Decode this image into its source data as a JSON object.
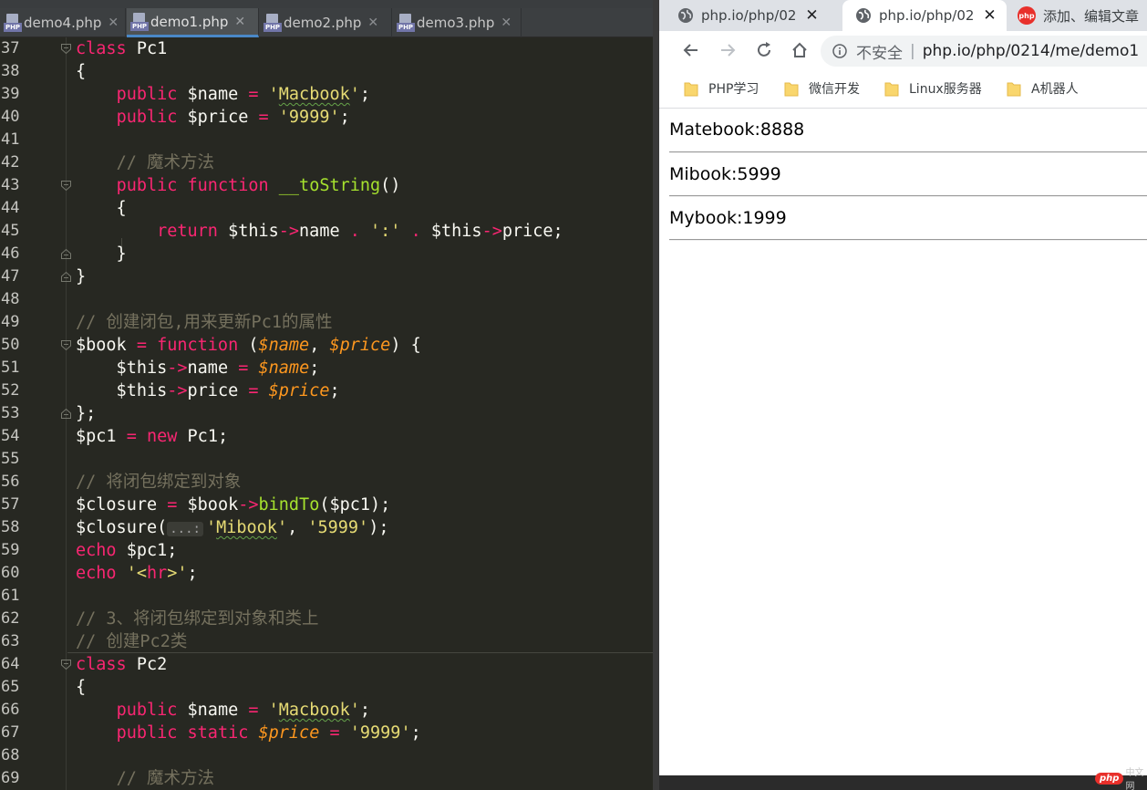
{
  "editor": {
    "menu_hint": "✎",
    "tabs": [
      {
        "label": "demo4.php",
        "active": false
      },
      {
        "label": "demo1.php",
        "active": true
      },
      {
        "label": "demo2.php",
        "active": false
      },
      {
        "label": "demo3.php",
        "active": false
      }
    ],
    "file_badge": "PHP",
    "lines": [
      {
        "n": "37",
        "html": "<span class='kw'>class</span> Pc1"
      },
      {
        "n": "38",
        "html": "{"
      },
      {
        "n": "39",
        "html": "    <span class='kw'>public</span> $name <span class='op'>=</span> <span class='str'>'<span class='squig'>Macbook</span>'</span>;"
      },
      {
        "n": "40",
        "html": "    <span class='kw'>public</span> $price <span class='op'>=</span> <span class='str'>'9999'</span>;"
      },
      {
        "n": "41",
        "html": ""
      },
      {
        "n": "42",
        "html": "    <span class='cmt'>// 魔术方法</span>"
      },
      {
        "n": "43",
        "html": "    <span class='kw'>public</span> <span class='kw'>function</span> <span class='fn'>__toString</span>()"
      },
      {
        "n": "44",
        "html": "    {"
      },
      {
        "n": "45",
        "html": "        <span class='kw'>return</span> $this<span class='op'>-&gt;</span>name <span class='op'>.</span> <span class='str'>':'</span> <span class='op'>.</span> $this<span class='op'>-&gt;</span>price;"
      },
      {
        "n": "46",
        "html": "    }"
      },
      {
        "n": "47",
        "html": "}"
      },
      {
        "n": "48",
        "html": ""
      },
      {
        "n": "49",
        "html": "<span class='cmt'>// 创建闭包,用来更新Pc1的属性</span>"
      },
      {
        "n": "50",
        "html": "$book <span class='op'>=</span> <span class='kw'>function</span> (<span class='param'>$name</span>, <span class='param'>$price</span>) {"
      },
      {
        "n": "51",
        "html": "    $this<span class='op'>-&gt;</span>name <span class='op'>=</span> <span class='param'>$name</span>;"
      },
      {
        "n": "52",
        "html": "    $this<span class='op'>-&gt;</span>price <span class='op'>=</span> <span class='param'>$price</span>;"
      },
      {
        "n": "53",
        "html": "};"
      },
      {
        "n": "54",
        "html": "$pc1 <span class='op'>=</span> <span class='kw'>new</span> Pc1;"
      },
      {
        "n": "55",
        "html": ""
      },
      {
        "n": "56",
        "html": "<span class='cmt'>// 将闭包绑定到对象</span>"
      },
      {
        "n": "57",
        "html": "$closure <span class='op'>=</span> $book<span class='op'>-&gt;</span><span class='fn'>bindTo</span>($pc1);"
      },
      {
        "n": "58",
        "html": "$closure(<span class='hint'>...:</span><span class='str'>'<span class='squig'>Mibook</span>'</span>, <span class='str'>'5999'</span>);"
      },
      {
        "n": "59",
        "html": "<span class='kw'>echo</span> $pc1;"
      },
      {
        "n": "60",
        "html": "<span class='kw'>echo</span> <span class='str'>'&lt;<span class='kw'>hr</span>&gt;'</span>;"
      },
      {
        "n": "61",
        "html": ""
      },
      {
        "n": "62",
        "html": "<span class='cmt'>// 3、将闭包绑定到对象和类上</span>"
      },
      {
        "n": "63",
        "html": "<span class='cmt'>// 创建Pc2类</span>"
      },
      {
        "n": "64",
        "html": "<span class='kw'>class</span> Pc2"
      },
      {
        "n": "65",
        "html": "{"
      },
      {
        "n": "66",
        "html": "    <span class='kw'>public</span> $name <span class='op'>=</span> <span class='str'>'<span class='squig'>Macbook</span>'</span>;"
      },
      {
        "n": "67",
        "html": "    <span class='kw'>public</span> <span class='kw'>static</span> <span class='param'>$price</span> <span class='op'>=</span> <span class='str'>'9999'</span>;"
      },
      {
        "n": "68",
        "html": ""
      },
      {
        "n": "69",
        "html": "    <span class='cmt'>// 魔术方法</span>"
      }
    ]
  },
  "browser": {
    "tabs": [
      {
        "label": "php.io/php/02",
        "active": false
      },
      {
        "label": "php.io/php/02",
        "active": true
      },
      {
        "label": "添加、编辑文章",
        "active": false
      }
    ],
    "tab_close": "✕",
    "php_badge": "php",
    "omnibox": {
      "security": "不安全",
      "divider": "|",
      "url": "php.io/php/0214/me/demo1"
    },
    "bookmarks": [
      "PHP学习",
      "微信开发",
      "Linux服务器",
      "A机器人"
    ],
    "output": [
      "Matebook:8888",
      "Mibook:5999",
      "Mybook:1999"
    ],
    "watermark": {
      "logo": "php",
      "text": "中文网"
    }
  },
  "colors": {
    "editor_bg": "#272822",
    "keyword": "#f92672",
    "string": "#e6db74",
    "comment": "#75715e",
    "function": "#a6e22e",
    "param": "#fd971f",
    "tab_accent": "#4a88c7"
  }
}
